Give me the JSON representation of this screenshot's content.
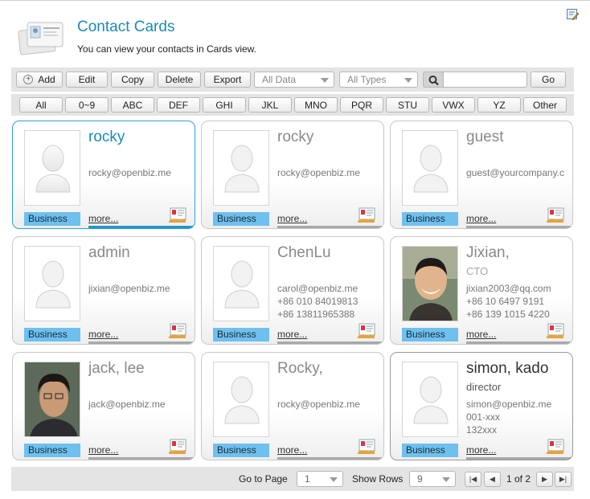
{
  "header": {
    "title": "Contact Cards",
    "subtitle": "You can view your contacts in Cards view."
  },
  "toolbar": {
    "add_label": "Add",
    "edit_label": "Edit",
    "copy_label": "Copy",
    "delete_label": "Delete",
    "export_label": "Export",
    "data_filter": "All Data",
    "type_filter": "All Types",
    "search_value": "",
    "go_label": "Go"
  },
  "alphabet": [
    "All",
    "0~9",
    "ABC",
    "DEF",
    "GHI",
    "JKL",
    "MNO",
    "PQR",
    "STU",
    "VWX",
    "YZ",
    "Other"
  ],
  "cards": [
    {
      "name": "rocky",
      "role": "",
      "lines": [
        "rocky@openbiz.me"
      ],
      "badge": "Business",
      "more": "more...",
      "photo": "placeholder-silhouette"
    },
    {
      "name": "rocky",
      "role": "",
      "lines": [
        "rocky@openbiz.me"
      ],
      "badge": "Business",
      "more": "more...",
      "photo": "placeholder-silhouette"
    },
    {
      "name": "guest",
      "role": "",
      "lines": [
        "guest@yourcompany.c"
      ],
      "badge": "Business",
      "more": "more...",
      "photo": "placeholder-silhouette"
    },
    {
      "name": "admin",
      "role": "",
      "lines": [
        "jixian@openbiz.me"
      ],
      "badge": "Business",
      "more": "more...",
      "photo": "placeholder-silhouette"
    },
    {
      "name": "ChenLu",
      "role": "",
      "lines": [
        "carol@openbiz.me",
        "+86 010 84019813",
        "+86 13811965388"
      ],
      "badge": "Business",
      "more": "more...",
      "photo": "placeholder-silhouette"
    },
    {
      "name": "Jixian,",
      "role": "CTO",
      "lines": [
        "jixian2003@qq.com",
        "+86 10 6497 9191",
        "+86 139 1015 4220"
      ],
      "badge": "Business",
      "more": "more...",
      "photo": "portrait-photo"
    },
    {
      "name": "jack, lee",
      "role": "",
      "lines": [
        "jack@openbiz.me"
      ],
      "badge": "Business",
      "more": "more...",
      "photo": "portrait-photo"
    },
    {
      "name": "Rocky,",
      "role": "",
      "lines": [
        "rocky@openbiz.me"
      ],
      "badge": "Business",
      "more": "more...",
      "photo": "placeholder-silhouette"
    },
    {
      "name": "simon, kado",
      "role": "director",
      "lines": [
        "simon@openbiz.me",
        "001-xxx",
        "132xxx"
      ],
      "badge": "Business",
      "more": "more...",
      "photo": "placeholder-silhouette"
    }
  ],
  "pager": {
    "goto_label": "Go to Page",
    "page_value": "1",
    "rows_label": "Show Rows",
    "rows_value": "9",
    "page_info": "1 of 2"
  },
  "icons": {
    "edit_corner": "edit-note-icon",
    "header": "contact-cards-icon",
    "search": "magnifier-icon",
    "vcard": "vcard-icon"
  },
  "colors": {
    "accent": "#1c8ab8",
    "badge": "#6ec0ee",
    "toolbar_bg": "#e4e4e4"
  }
}
